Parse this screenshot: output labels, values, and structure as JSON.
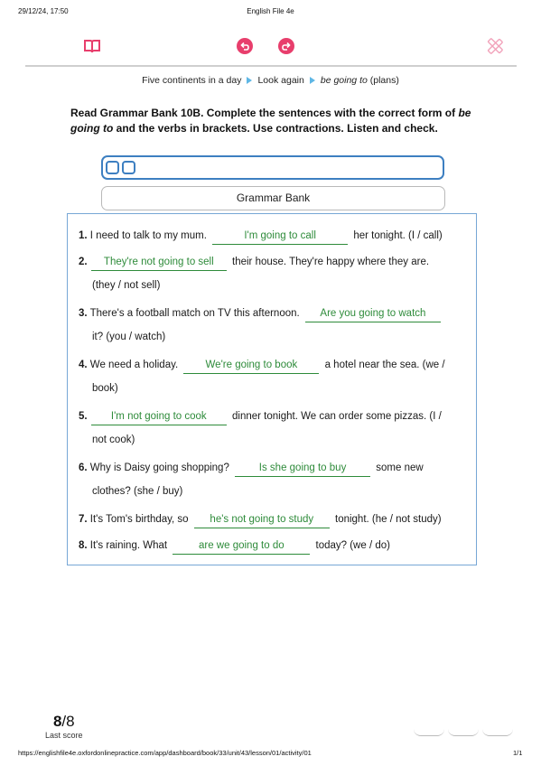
{
  "print": {
    "datetime": "29/12/24, 17:50",
    "title": "English File 4e",
    "url": "https://englishfile4e.oxfordonlinepractice.com/app/dashboard/book/33/unit/43/lesson/01/activity/01",
    "page": "1/1"
  },
  "toolbar": {
    "book_icon": "open-book-icon",
    "undo_icon": "undo-icon",
    "redo_icon": "redo-icon",
    "tools_icon": "pencil-ruler-icon",
    "accent_color": "#e83e6c"
  },
  "breadcrumb": {
    "item1": "Five continents in a day",
    "item2": "Look again",
    "item3_italic": "be going to",
    "item3_rest": " (plans)"
  },
  "instructions": {
    "part1": "Read Grammar Bank 10B. Complete the sentences with the correct form of ",
    "italic": "be going to",
    "part2": " and the verbs in brackets. Use contractions. Listen and check."
  },
  "grammar_bank_button": "Grammar Bank",
  "items": [
    {
      "num": "1.",
      "before": "I need to talk to my mum.",
      "answer": "I'm going to call",
      "after": "her tonight. (I / call)",
      "line2": ""
    },
    {
      "num": "2.",
      "before": "",
      "answer": "They're not going to sell",
      "after": "their house. They're happy where they are.",
      "line2": "(they / not sell)"
    },
    {
      "num": "3.",
      "before": "There's a football match on TV this afternoon.",
      "answer": "Are you going to watch",
      "after": "",
      "line2": "it? (you / watch)"
    },
    {
      "num": "4.",
      "before": "We need a holiday.",
      "answer": "We're going to book",
      "after": "a hotel near the sea. (we /",
      "line2": "book)"
    },
    {
      "num": "5.",
      "before": "",
      "answer": "I'm not going to cook",
      "after": "dinner tonight. We can order some pizzas. (I /",
      "line2": "not cook)"
    },
    {
      "num": "6.",
      "before": "Why is Daisy going shopping?",
      "answer": "Is she going to buy",
      "after": "some new",
      "line2": "clothes? (she / buy)"
    },
    {
      "num": "7.",
      "before": "It's Tom's birthday, so",
      "answer": "he's not going to study",
      "after": "tonight. (he / not study)",
      "line2": ""
    },
    {
      "num": "8.",
      "before": "It's raining. What",
      "answer": "are we going to do",
      "after": "today? (we / do)",
      "line2": ""
    }
  ],
  "answer_color": "#2e8b3a",
  "score": {
    "value": "8",
    "total": "/8",
    "label": "Last score"
  }
}
